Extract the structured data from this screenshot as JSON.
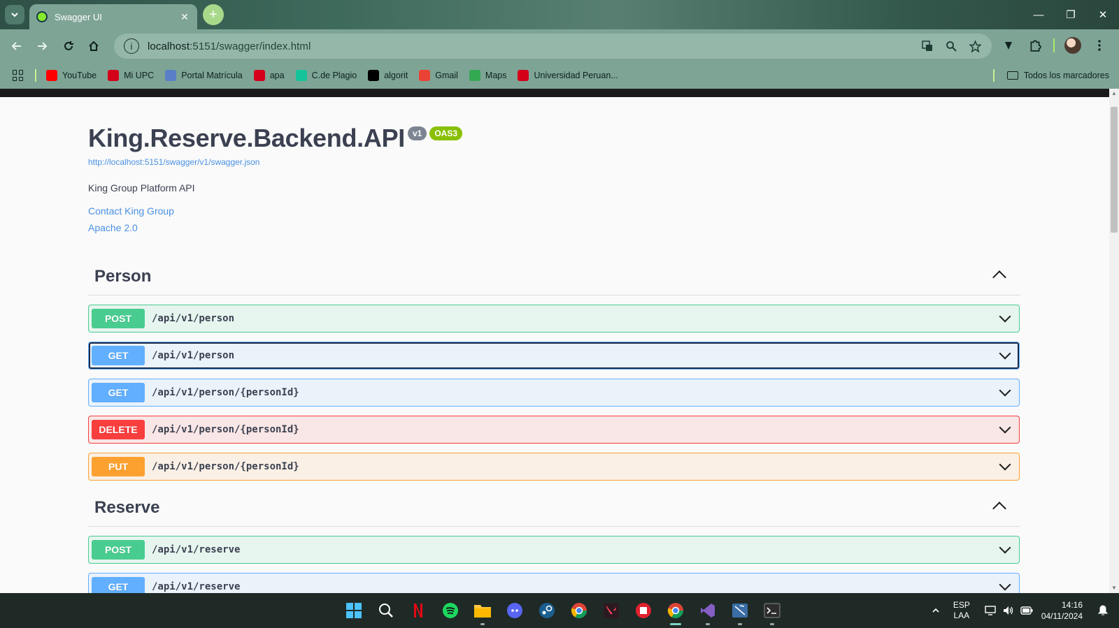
{
  "browser": {
    "tab_title": "Swagger UI",
    "tab_close": "✕",
    "new_tab": "+",
    "url_host": "localhost",
    "url_path": ":5151/swagger/index.html",
    "window_controls": {
      "minimize": "—",
      "restore": "❐",
      "close": "✕"
    },
    "bookmarks": [
      {
        "label": "YouTube",
        "icon": "youtube-icon",
        "color": "#ff0000"
      },
      {
        "label": "Mi UPC",
        "icon": "upc-icon",
        "color": "#d4001a"
      },
      {
        "label": "Portal Matrícula",
        "icon": "document-icon",
        "color": "#5a7fc8"
      },
      {
        "label": "apa",
        "icon": "upc-icon",
        "color": "#d4001a"
      },
      {
        "label": "C.de Plagio",
        "icon": "grammarly-icon",
        "color": "#15c39a"
      },
      {
        "label": "algorit",
        "icon": "p-icon",
        "color": "#000000"
      },
      {
        "label": "Gmail",
        "icon": "gmail-icon",
        "color": "#ea4335"
      },
      {
        "label": "Maps",
        "icon": "maps-icon",
        "color": "#34a853"
      },
      {
        "label": "Universidad Peruan...",
        "icon": "upc-icon",
        "color": "#d4001a"
      }
    ],
    "all_bookmarks": "Todos los marcadores"
  },
  "swagger": {
    "title": "King.Reserve.Backend.API",
    "version": "v1",
    "oas": "OAS3",
    "spec_url": "http://localhost:5151/swagger/v1/swagger.json",
    "description": "King Group Platform API",
    "contact": "Contact King Group",
    "license": "Apache 2.0",
    "tags": [
      {
        "name": "Person",
        "operations": [
          {
            "method": "POST",
            "path": "/api/v1/person"
          },
          {
            "method": "GET",
            "path": "/api/v1/person"
          },
          {
            "method": "GET",
            "path": "/api/v1/person/{personId}"
          },
          {
            "method": "DELETE",
            "path": "/api/v1/person/{personId}"
          },
          {
            "method": "PUT",
            "path": "/api/v1/person/{personId}"
          }
        ]
      },
      {
        "name": "Reserve",
        "operations": [
          {
            "method": "POST",
            "path": "/api/v1/reserve"
          },
          {
            "method": "GET",
            "path": "/api/v1/reserve"
          }
        ]
      }
    ]
  },
  "taskbar": {
    "lang_top": "ESP",
    "lang_bottom": "LAA",
    "time": "14:16",
    "date": "04/11/2024"
  },
  "colors": {
    "post": "#49cc90",
    "get": "#61affe",
    "delete": "#f93e3e",
    "put": "#fca130"
  }
}
